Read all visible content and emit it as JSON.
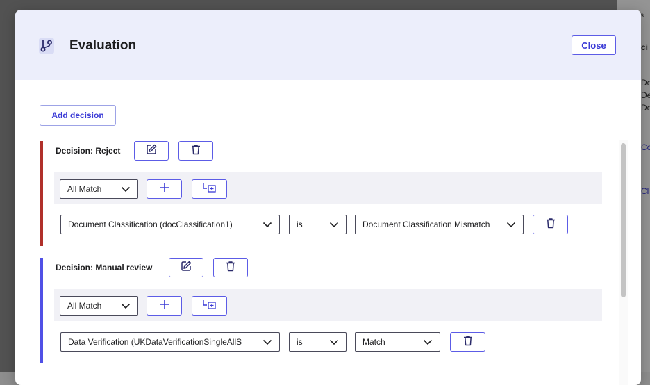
{
  "background_page": {
    "fragments": [
      "s",
      "ci",
      "De",
      "De",
      "De",
      "Co",
      "Cl"
    ]
  },
  "modal": {
    "title": "Evaluation",
    "title_icon": "branch-icon",
    "close_label": "Close",
    "add_decision_label": "Add decision"
  },
  "decisions": [
    {
      "label": "Decision: Reject",
      "accent": "#b0302a",
      "match_value": "All Match",
      "condition": {
        "field": "Document Classification (docClassification1)",
        "operator": "is",
        "value": "Document Classification Mismatch"
      }
    },
    {
      "label": "Decision: Manual review",
      "accent": "#5050e6",
      "match_value": "All Match",
      "condition": {
        "field": "Data Verification (UKDataVerificationSingleAllS",
        "operator": "is",
        "value": "Match"
      }
    }
  ],
  "colors": {
    "primary": "#3a3ad6",
    "header_bg": "#eceefb",
    "band_bg": "#f1f1f6"
  }
}
